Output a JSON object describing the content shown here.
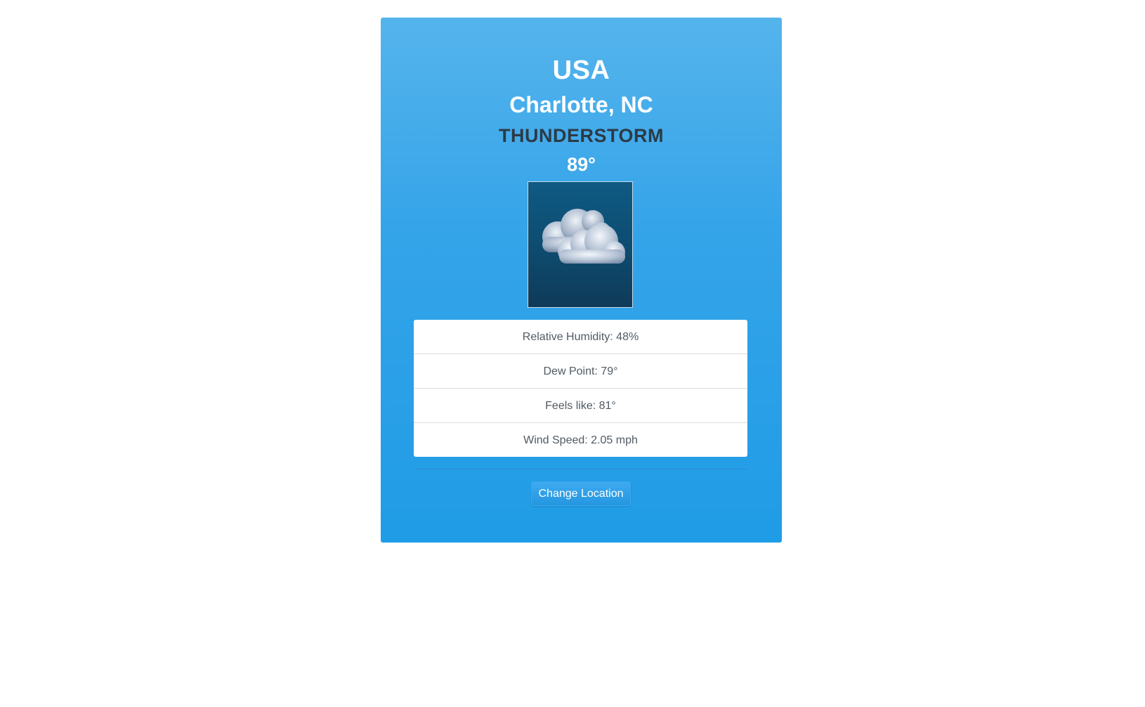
{
  "location": {
    "country": "USA",
    "city": "Charlotte, NC"
  },
  "current": {
    "condition": "THUNDERSTORM",
    "temperature": "89°",
    "icon": "cloud-icon"
  },
  "details": [
    {
      "label": "Relative Humidity: 48%"
    },
    {
      "label": "Dew Point: 79°"
    },
    {
      "label": "Feels like: 81°"
    },
    {
      "label": "Wind Speed: 2.05 mph"
    }
  ],
  "actions": {
    "change_location_label": "Change Location"
  },
  "colors": {
    "card_top": "#55b4ec",
    "card_bottom": "#1f9ce6",
    "condition_text": "#2b3a47",
    "detail_text": "#505a63"
  }
}
